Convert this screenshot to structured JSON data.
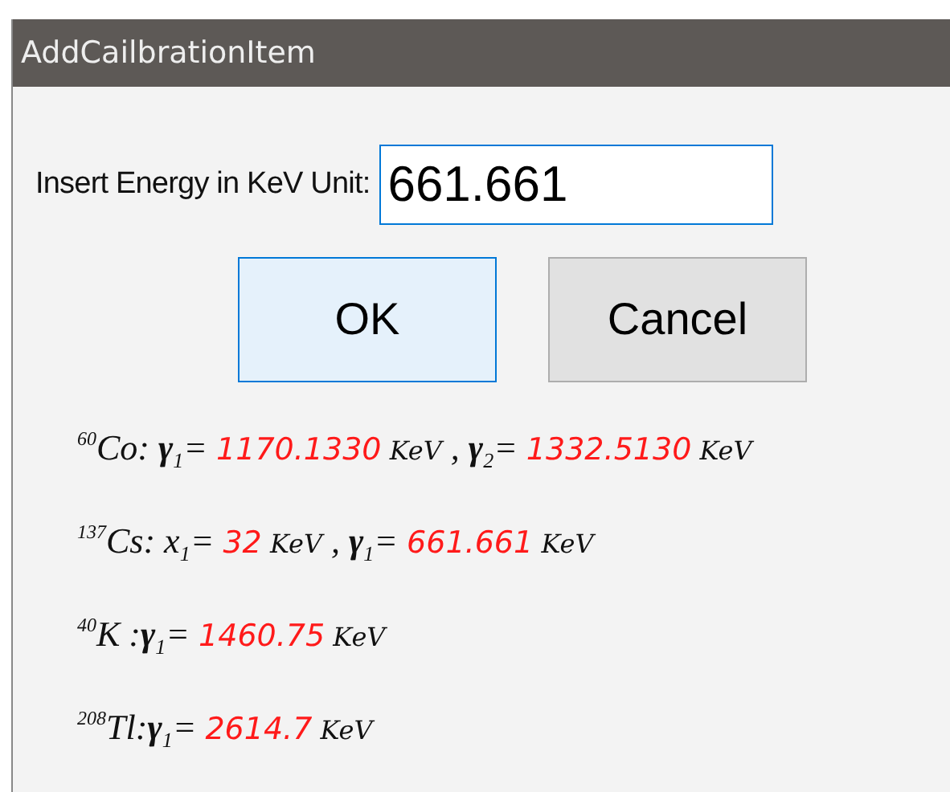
{
  "window": {
    "title": "AddCailbrationItem"
  },
  "energy_field": {
    "label": "Insert Energy in KeV Unit:",
    "value": "661.661"
  },
  "buttons": [
    {
      "label": "OK",
      "kind": "default"
    },
    {
      "label": "Cancel",
      "kind": "normal"
    }
  ],
  "lines": [
    {
      "segments": [
        {
          "kind": "label",
          "text": "$^{60}$Co: **γ**$_{1}$= "
        },
        {
          "kind": "value",
          "text": "1170.1330"
        },
        {
          "kind": "unit",
          "text": " KeV"
        },
        {
          "kind": "label",
          "text": " , **γ**$_{2}$= "
        },
        {
          "kind": "value",
          "text": "1332.5130"
        },
        {
          "kind": "unit",
          "text": " KeV"
        }
      ]
    },
    {
      "segments": [
        {
          "kind": "label",
          "text": "$^{137}$Cs: x$_{1}$= "
        },
        {
          "kind": "value",
          "text": "32"
        },
        {
          "kind": "unit",
          "text": " KeV"
        },
        {
          "kind": "label",
          "text": " , **γ**$_{1}$= "
        },
        {
          "kind": "value",
          "text": "661.661"
        },
        {
          "kind": "unit",
          "text": " KeV"
        }
      ]
    },
    {
      "segments": [
        {
          "kind": "label",
          "text": "$^{40}$K :**γ**$_{1}$= "
        },
        {
          "kind": "value",
          "text": "1460.75"
        },
        {
          "kind": "unit",
          "text": " KeV"
        }
      ]
    },
    {
      "segments": [
        {
          "kind": "label",
          "text": "$^{208}$Tl:**γ**$_{1}$= "
        },
        {
          "kind": "value",
          "text": "2614.7"
        },
        {
          "kind": "unit",
          "text": " KeV"
        }
      ]
    }
  ]
}
